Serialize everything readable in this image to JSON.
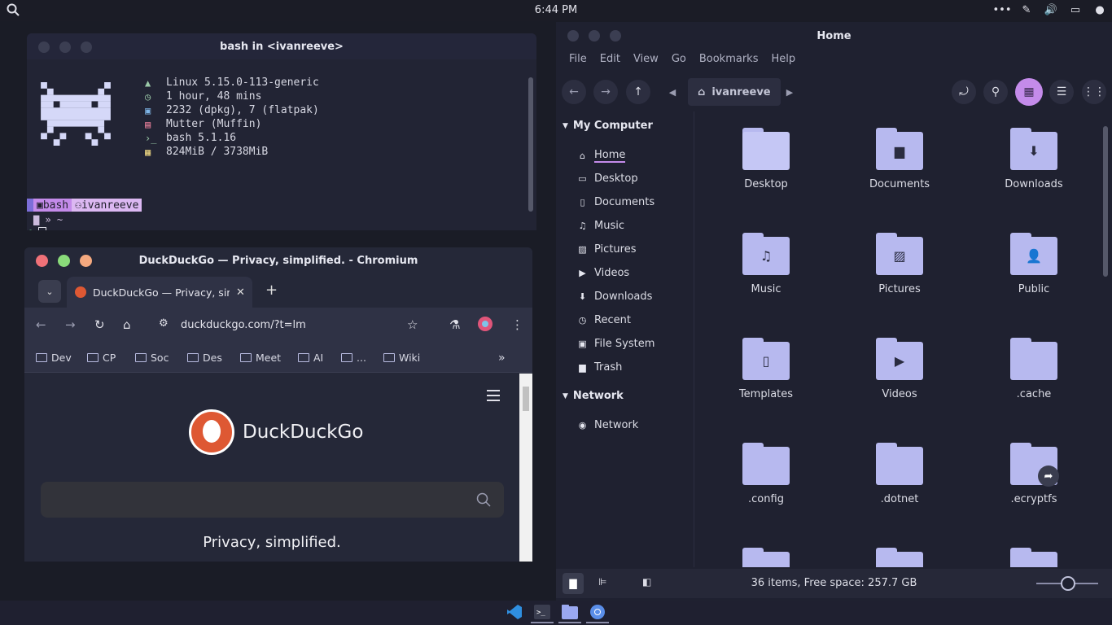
{
  "top_panel": {
    "clock": "6:44 PM",
    "icons": [
      "search-icon",
      "more-icon",
      "eyedropper-icon",
      "volume-icon",
      "display-icon",
      "user-icon"
    ]
  },
  "terminal": {
    "title": "bash in <ivanreeve>",
    "sysinfo": [
      {
        "icon": "arch-icon",
        "text": "Linux 5.15.0-113-generic"
      },
      {
        "icon": "clock-icon",
        "text": "1 hour, 48 mins"
      },
      {
        "icon": "package-icon",
        "text": "2232 (dpkg), 7 (flatpak)"
      },
      {
        "icon": "window-icon",
        "text": "Mutter (Muffin)"
      },
      {
        "icon": "terminal-icon",
        "text": "bash 5.1.16"
      },
      {
        "icon": "memory-icon",
        "text": "824MiB / 3738MiB"
      }
    ],
    "prompt": {
      "seg_shell": "bash",
      "seg_user": "ivanreeve",
      "path_line": "» ~",
      "cursor_symbol": "❯"
    }
  },
  "chromium": {
    "title": "DuckDuckGo — Privacy, simplified. - Chromium",
    "tab_title": "DuckDuckGo — Privacy, simpl",
    "url": "duckduckgo.com/?t=lm",
    "bookmarks": [
      "Dev",
      "CP",
      "Soc",
      "Des",
      "Meet",
      "AI",
      "...",
      "Wiki"
    ],
    "page": {
      "brand": "DuckDuckGo",
      "tagline": "Privacy, simplified."
    }
  },
  "files": {
    "title": "Home",
    "menu": [
      "File",
      "Edit",
      "View",
      "Go",
      "Bookmarks",
      "Help"
    ],
    "path": "ivanreeve",
    "sidebar": {
      "sections": [
        {
          "label": "My Computer",
          "items": [
            "Home",
            "Desktop",
            "Documents",
            "Music",
            "Pictures",
            "Videos",
            "Downloads",
            "Recent",
            "File System",
            "Trash"
          ]
        },
        {
          "label": "Network",
          "items": [
            "Network"
          ]
        }
      ]
    },
    "items": [
      {
        "name": "Desktop",
        "glyph": ""
      },
      {
        "name": "Documents",
        "glyph": "▆"
      },
      {
        "name": "Downloads",
        "glyph": "⬇"
      },
      {
        "name": "Music",
        "glyph": "♫"
      },
      {
        "name": "Pictures",
        "glyph": "▨"
      },
      {
        "name": "Public",
        "glyph": "👤"
      },
      {
        "name": "Templates",
        "glyph": "▯"
      },
      {
        "name": "Videos",
        "glyph": "▶"
      },
      {
        "name": ".cache",
        "glyph": ""
      },
      {
        "name": ".config",
        "glyph": ""
      },
      {
        "name": ".dotnet",
        "glyph": ""
      },
      {
        "name": ".ecryptfs",
        "glyph": ""
      }
    ],
    "status": "36 items, Free space: 257.7 GB"
  },
  "colors": {
    "accent": "#b7b9ef",
    "accent_active": "#c48bea"
  }
}
